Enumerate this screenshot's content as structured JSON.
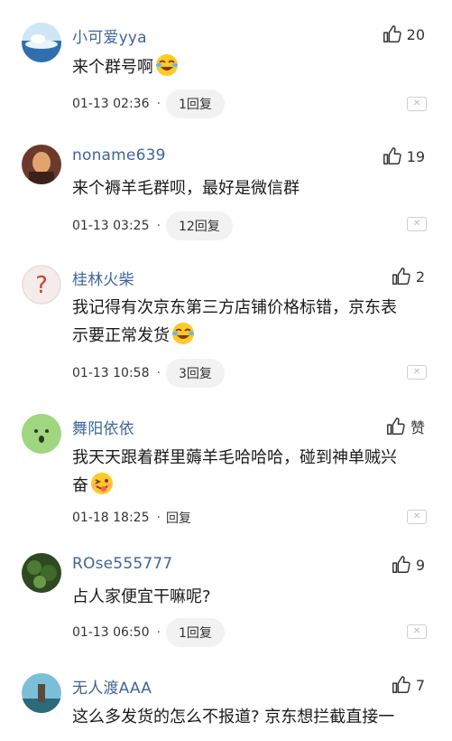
{
  "comments": [
    {
      "user": "小可爱yya",
      "likes": "20",
      "text": "来个群号啊",
      "emoji": "laugh-cry",
      "time": "01-13 02:36",
      "replies": "1回复",
      "reply_style": "pill"
    },
    {
      "user": "noname639",
      "likes": "19",
      "text": "来个褥羊毛群呗，最好是微信群",
      "time": "01-13 03:25",
      "replies": "12回复",
      "reply_style": "pill"
    },
    {
      "user": "桂林火柴",
      "likes": "2",
      "text_line1": "我记得有次京东第三方店铺价格标错，京东表",
      "text_line2": "示要正常发货",
      "emoji": "laugh-cry",
      "time": "01-13 10:58",
      "replies": "3回复",
      "reply_style": "pill"
    },
    {
      "user": "舞阳依依",
      "likes": "赞",
      "text_line1": "我天天跟着群里薅羊毛哈哈哈，碰到神单贼兴",
      "text_line2": "奋",
      "emoji": "wink",
      "time": "01-18 18:25",
      "replies": "回复",
      "reply_style": "plain"
    },
    {
      "user": "ROse555777",
      "likes": "9",
      "text": "占人家便宜干嘛呢?",
      "time": "01-13 06:50",
      "replies": "1回复",
      "reply_style": "pill"
    },
    {
      "user": "无人渡AAA",
      "likes": "7",
      "text": "这么多发货的怎么不报道? 京东想拦截直接一"
    }
  ],
  "colors": {
    "username": "#406599",
    "text": "#1a1a1a",
    "pill_bg": "#f2f2f2"
  }
}
